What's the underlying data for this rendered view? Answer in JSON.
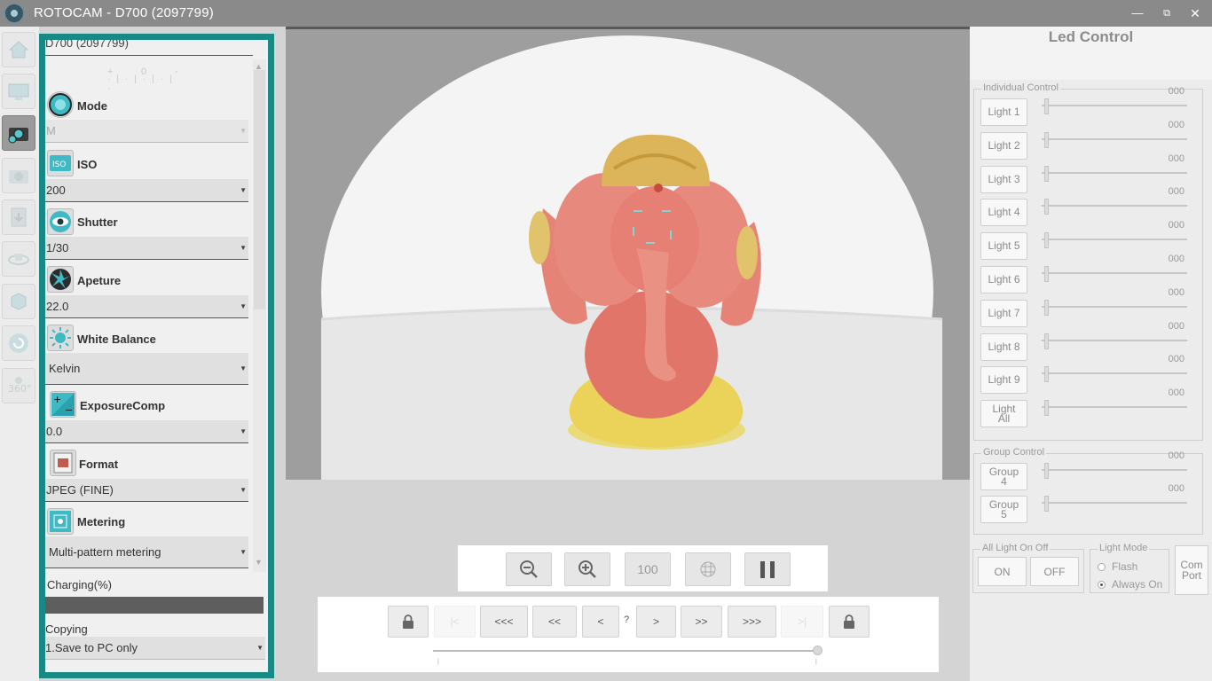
{
  "window": {
    "title": "ROTOCAM - D700 (2097799)",
    "minimize": "—",
    "maximize": "⧉",
    "close": "✕"
  },
  "toolbar": {
    "items": [
      {
        "name": "home-icon"
      },
      {
        "name": "monitor-icon"
      },
      {
        "name": "camera-settings-icon",
        "active": true
      },
      {
        "name": "camera-icon"
      },
      {
        "name": "save-icon"
      },
      {
        "name": "rotate-object-icon"
      },
      {
        "name": "cube-icon"
      },
      {
        "name": "refresh-icon"
      },
      {
        "name": "360-view-icon"
      }
    ]
  },
  "settings": {
    "camera_model": "D700 (2097799)",
    "ev_plus": "+",
    "ev_zero": "0",
    "ev_minus": "-",
    "mode": {
      "label": "Mode",
      "value": "M"
    },
    "iso": {
      "label": "ISO",
      "value": "200"
    },
    "shutter": {
      "label": "Shutter",
      "value": "1/30"
    },
    "aperture": {
      "label": "Apeture",
      "value": "22.0"
    },
    "white_balance": {
      "label": "White Balance",
      "value": "Kelvin"
    },
    "exposure_comp": {
      "label": "ExposureComp",
      "value": "0.0"
    },
    "format": {
      "label": "Format",
      "value": "JPEG (FINE)"
    },
    "metering": {
      "label": "Metering",
      "value": "Multi-pattern metering"
    },
    "charging_label": "Charging(%)",
    "charging_percent": 100,
    "copying_label": "Copying",
    "copying_value": "1.Save to PC only"
  },
  "zoom": {
    "zoom_100": "100"
  },
  "navigation": {
    "first": "|<",
    "back_3": "<<<",
    "back_2": "<<",
    "back_1": "<",
    "counter": "?",
    "fwd_1": ">",
    "fwd_2": ">>",
    "fwd_3": ">>>",
    "last": ">|"
  },
  "led": {
    "title": "Led Control",
    "individual_title": "Individual Control",
    "lights": [
      {
        "label": "Light 1",
        "value": "000"
      },
      {
        "label": "Light 2",
        "value": "000"
      },
      {
        "label": "Light 3",
        "value": "000"
      },
      {
        "label": "Light 4",
        "value": "000"
      },
      {
        "label": "Light 5",
        "value": "000"
      },
      {
        "label": "Light 6",
        "value": "000"
      },
      {
        "label": "Light 7",
        "value": "000"
      },
      {
        "label": "Light 8",
        "value": "000"
      },
      {
        "label": "Light 9",
        "value": "000"
      },
      {
        "label": "Light All",
        "value": "000"
      }
    ],
    "group_title": "Group Control",
    "groups": [
      {
        "label": "Group 4",
        "value": "000"
      },
      {
        "label": "Group 5",
        "value": "000"
      }
    ],
    "all_title": "All Light On Off",
    "on_label": "ON",
    "off_label": "OFF",
    "mode_title": "Light Mode",
    "mode_flash": "Flash",
    "mode_always": "Always On",
    "com_port": "Com Port"
  }
}
